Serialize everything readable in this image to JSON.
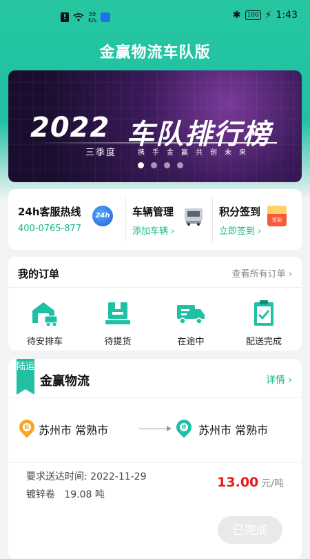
{
  "status_bar": {
    "speed": "59",
    "speed_unit": "K/s",
    "battery": "100",
    "time": "1:43"
  },
  "app": {
    "title": "金赢物流车队版",
    "accent": "#1fc0a4"
  },
  "banner": {
    "year": "2022",
    "title": "车队排行榜",
    "quarter": "三季度",
    "slogan": "携手金赢共创未来",
    "slide_count": 4,
    "active_slide": 1
  },
  "quick_actions": [
    {
      "title": "24h客服热线",
      "sub": "400-0765-877",
      "icon": "24h-service-icon",
      "icon_text": "24h"
    },
    {
      "title": "车辆管理",
      "sub": "添加车辆 ›",
      "icon": "truck-icon"
    },
    {
      "title": "积分签到",
      "sub": "立即签到 ›",
      "icon": "sign-in-gift-icon",
      "icon_text": "签到"
    }
  ],
  "orders": {
    "title": "我的订单",
    "view_all": "查看所有订单 ›",
    "items": [
      {
        "label": "待安排车",
        "icon": "warehouse-truck-icon"
      },
      {
        "label": "待提货",
        "icon": "package-icon"
      },
      {
        "label": "在途中",
        "icon": "delivery-truck-icon"
      },
      {
        "label": "配送完成",
        "icon": "clipboard-check-icon"
      }
    ]
  },
  "shipment": {
    "tag": "陆运",
    "company": "金赢物流",
    "details": "详情 ›",
    "from_badge": "起",
    "from": "苏州市 常熟市",
    "to_badge": "终",
    "to": "苏州市 常熟市",
    "deadline_label": "要求送达时间:",
    "deadline": "2022-11-29",
    "cargo": "镀锌卷",
    "weight": "19.08 吨",
    "price": "13.00",
    "unit": "元/吨",
    "status": "已完成"
  }
}
